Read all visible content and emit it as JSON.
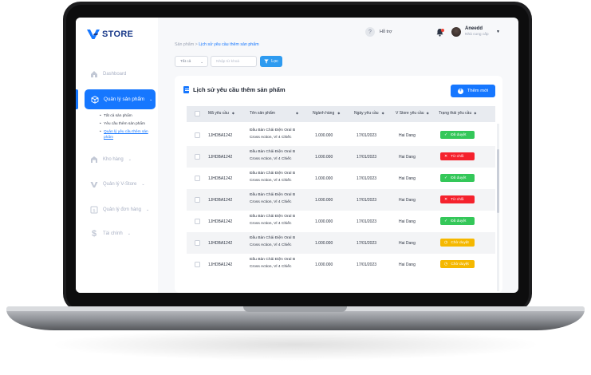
{
  "app": {
    "brand": "STORE"
  },
  "sidebar": {
    "items": [
      {
        "label": "Dashboard",
        "icon": "home-icon"
      },
      {
        "label": "Quản lý sản phẩm",
        "icon": "box-icon",
        "active": true
      },
      {
        "label": "Kho hàng",
        "icon": "warehouse-icon"
      },
      {
        "label": "Quản lý V-Store",
        "icon": "v-store-icon"
      },
      {
        "label": "Quản lý đơn hàng",
        "icon": "order-icon"
      },
      {
        "label": "Tài chính",
        "icon": "dollar-icon"
      }
    ],
    "subitems": [
      {
        "label": "Tất cả sản phẩm"
      },
      {
        "label": "Yêu cầu thêm sản phẩm"
      },
      {
        "label": "Quản lý yêu cầu thêm sản phẩm",
        "active": true
      }
    ]
  },
  "topbar": {
    "help_label": "Hỗ trợ",
    "user_name": "Aneedd",
    "user_role": "Nhà cung cấp"
  },
  "breadcrumb": {
    "root": "Sản phẩm",
    "separator": ">",
    "current": "Lịch sử yêu cầu thêm sản phẩm"
  },
  "filters": {
    "select_value": "Tất cả",
    "search_placeholder": "Nhập từ khoá",
    "filter_button": "Lọc"
  },
  "card": {
    "title": "Lịch sử yêu cầu thêm sản phẩm",
    "add_button": "Thêm mới"
  },
  "table": {
    "columns": [
      "Mã yêu cầu",
      "Tên sản phẩm",
      "Ngành hàng",
      "Ngày yêu cầu",
      "V Store yêu cầu",
      "Trạng thái yêu cầu"
    ],
    "rows": [
      {
        "code": "1JHDBA1242",
        "name": "Đầu Bàn Chải Điện Oral B Cross Action, Vỉ 4 Chiếc",
        "category": "1.000.000",
        "date": "17/01/2023",
        "store": "Hai Dang",
        "status": "Đã duyệt",
        "status_type": "approved"
      },
      {
        "code": "1JHDBA1242",
        "name": "Đầu Bàn Chải Điện Oral B Cross Action, Vỉ 4 Chiếc",
        "category": "1.000.000",
        "date": "17/01/2023",
        "store": "Hai Dang",
        "status": "Từ chối",
        "status_type": "rejected"
      },
      {
        "code": "1JHDBA1242",
        "name": "Đầu Bàn Chải Điện Oral B Cross Action, Vỉ 4 Chiếc",
        "category": "1.000.000",
        "date": "17/01/2023",
        "store": "Hai Dang",
        "status": "Đã duyệt",
        "status_type": "approved"
      },
      {
        "code": "1JHDBA1242",
        "name": "Đầu Bàn Chải Điện Oral B Cross Action, Vỉ 4 Chiếc",
        "category": "1.000.000",
        "date": "17/01/2023",
        "store": "Hai Dang",
        "status": "Từ chối",
        "status_type": "rejected"
      },
      {
        "code": "1JHDBA1242",
        "name": "Đầu Bàn Chải Điện Oral B Cross Action, Vỉ 4 Chiếc",
        "category": "1.000.000",
        "date": "17/01/2023",
        "store": "Hai Dang",
        "status": "Đã duyệt",
        "status_type": "approved"
      },
      {
        "code": "1JHDBA1242",
        "name": "Đầu Bàn Chải Điện Oral B Cross Action, Vỉ 4 Chiếc",
        "category": "1.000.000",
        "date": "17/01/2023",
        "store": "Hai Dang",
        "status": "Chờ duyệt",
        "status_type": "pending"
      },
      {
        "code": "1JHDBA1242",
        "name": "Đầu Bàn Chải Điện Oral B Cross Action, Vỉ 4 Chiếc",
        "category": "1.000.000",
        "date": "17/01/2023",
        "store": "Hai Dang",
        "status": "Chờ duyệt",
        "status_type": "pending"
      }
    ]
  },
  "colors": {
    "primary": "#1677ff",
    "approved": "#34c759",
    "rejected": "#f5222d",
    "pending": "#f5b800"
  }
}
